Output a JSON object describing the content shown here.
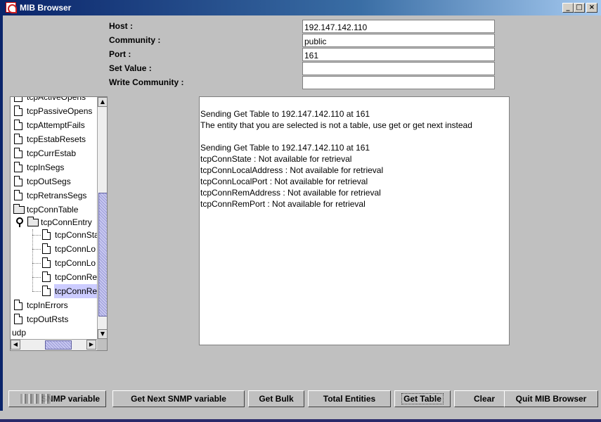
{
  "window": {
    "title": "MIB Browser"
  },
  "form": {
    "host_label": "Host :",
    "host_value": "192.147.142.110",
    "community_label": "Community :",
    "community_value": "public",
    "port_label": "Port :",
    "port_value": "161",
    "set_value_label": "Set Value :",
    "set_value_value": "",
    "write_community_label": "Write Community :",
    "write_community_value": ""
  },
  "tree": {
    "items": [
      {
        "label": "tcpActiveOpens",
        "icon": "document-icon"
      },
      {
        "label": "tcpPassiveOpens",
        "icon": "document-icon"
      },
      {
        "label": "tcpAttemptFails",
        "icon": "document-icon"
      },
      {
        "label": "tcpEstabResets",
        "icon": "document-icon"
      },
      {
        "label": "tcpCurrEstab",
        "icon": "document-icon"
      },
      {
        "label": "tcpInSegs",
        "icon": "document-icon"
      },
      {
        "label": "tcpOutSegs",
        "icon": "document-icon"
      },
      {
        "label": "tcpRetransSegs",
        "icon": "document-icon"
      },
      {
        "label": "tcpConnTable",
        "icon": "folder-icon"
      },
      {
        "label": "tcpConnEntry",
        "icon": "folder-icon"
      },
      {
        "label": "tcpConnSta",
        "icon": "document-icon"
      },
      {
        "label": "tcpConnLo",
        "icon": "document-icon"
      },
      {
        "label": "tcpConnLo",
        "icon": "document-icon"
      },
      {
        "label": "tcpConnRe",
        "icon": "document-icon"
      },
      {
        "label": "tcpConnRe",
        "icon": "document-icon",
        "selected": true
      },
      {
        "label": "tcpInErrors",
        "icon": "document-icon"
      },
      {
        "label": "tcpOutRsts",
        "icon": "document-icon"
      },
      {
        "label": "udp",
        "icon": ""
      }
    ]
  },
  "output": {
    "lines": [
      "Sending Get Table to 192.147.142.110 at 161",
      "The entity that you are selected is not a table, use get or get next instead",
      "",
      "Sending Get Table to 192.147.142.110 at 161",
      "tcpConnState : Not available for retrieval",
      "tcpConnLocalAddress : Not available for retrieval",
      "tcpConnLocalPort : Not available for retrieval",
      "tcpConnRemAddress : Not available for retrieval",
      "tcpConnRemPort : Not available for retrieval"
    ]
  },
  "buttons": {
    "get": "SNMP variable",
    "get_next": "Get Next SNMP variable",
    "get_bulk": "Get Bulk",
    "total_entities": "Total Entities",
    "get_table": "Get Table",
    "clear": "Clear",
    "quit": "Quit MIB Browser"
  }
}
